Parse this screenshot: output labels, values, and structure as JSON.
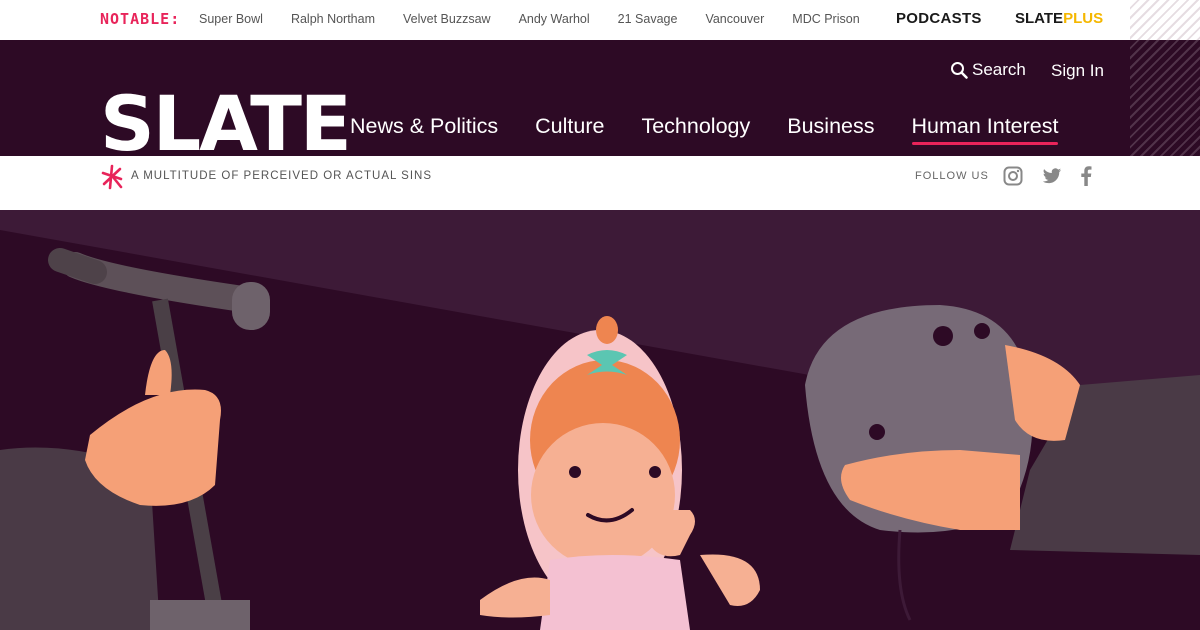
{
  "notable": {
    "label": "NOTABLE:",
    "links": [
      "Super Bowl",
      "Ralph Northam",
      "Velvet Buzzsaw",
      "Andy Warhol",
      "21 Savage",
      "Vancouver",
      "MDC Prison"
    ]
  },
  "promos": {
    "podcasts_label": "PODCASTS",
    "plus_a": "SLATE",
    "plus_b": "PLUS"
  },
  "header": {
    "search_label": "Search",
    "signin_label": "Sign In",
    "logo_text": "SLATE",
    "nav": [
      "News & Politics",
      "Culture",
      "Technology",
      "Business",
      "Human Interest"
    ],
    "active_nav": "Human Interest"
  },
  "subbar": {
    "tagline": "A MULTITUDE OF PERCEIVED OR ACTUAL SINS",
    "follow_label": "FOLLOW US",
    "social_icons": [
      "instagram-icon",
      "twitter-icon",
      "facebook-icon"
    ]
  },
  "colors": {
    "brand_dark": "#2d0a25",
    "accent_pink": "#e8245a",
    "plus_yellow": "#f5b700",
    "hero_bg": "#3d1a37"
  }
}
